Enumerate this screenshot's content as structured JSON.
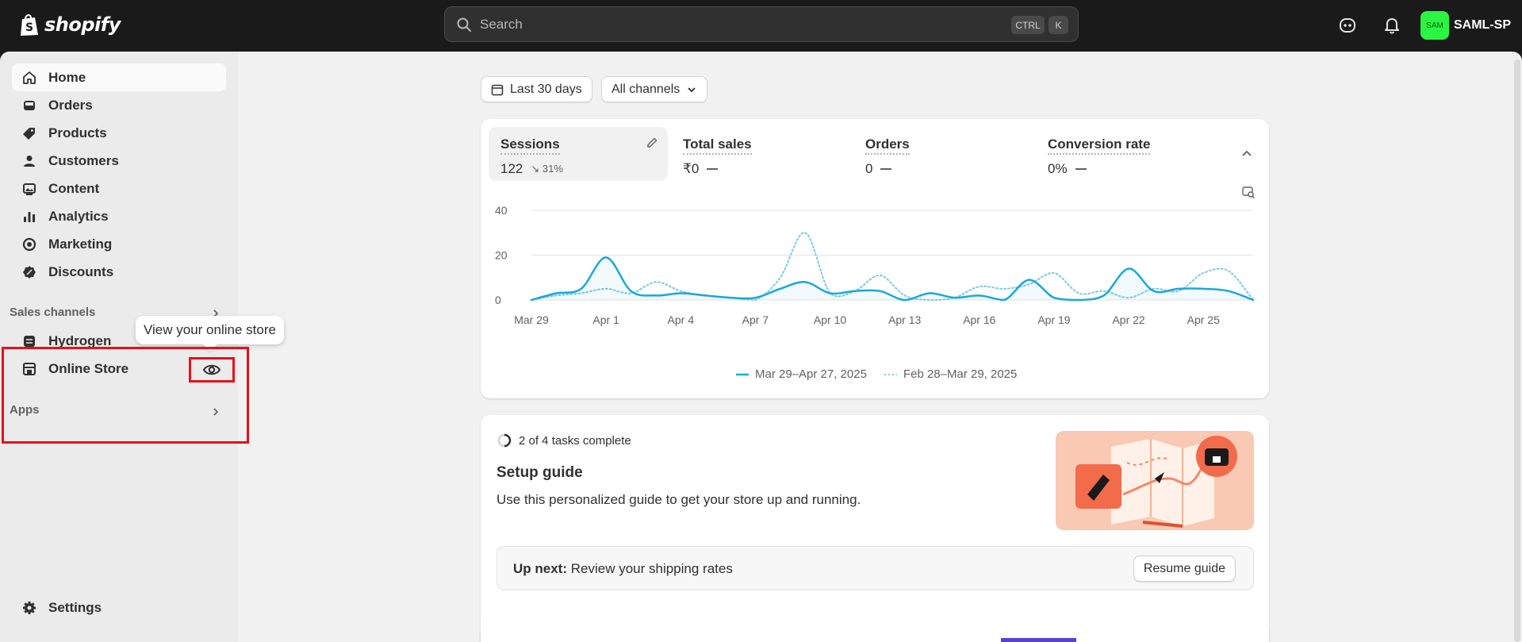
{
  "topbar": {
    "brand": "shopify",
    "search_placeholder": "Search",
    "shortcut_ctrl": "CTRL",
    "shortcut_k": "K",
    "avatar_initials": "SAM",
    "store_name": "SAML-SP",
    "avatar_color": "#2bf542"
  },
  "sidebar": {
    "items": [
      {
        "label": "Home",
        "icon": "home-icon"
      },
      {
        "label": "Orders",
        "icon": "inbox-icon"
      },
      {
        "label": "Products",
        "icon": "tag-icon"
      },
      {
        "label": "Customers",
        "icon": "person-icon"
      },
      {
        "label": "Content",
        "icon": "image-icon"
      },
      {
        "label": "Analytics",
        "icon": "bar-chart-icon"
      },
      {
        "label": "Marketing",
        "icon": "target-icon"
      },
      {
        "label": "Discounts",
        "icon": "discount-icon"
      }
    ],
    "sales_channels_label": "Sales channels",
    "channels": [
      {
        "label": "Hydrogen",
        "icon": "hydrogen-icon"
      },
      {
        "label": "Online Store",
        "icon": "store-icon"
      }
    ],
    "apps_label": "Apps",
    "settings_label": "Settings",
    "tooltip": "View your online store"
  },
  "filters": {
    "date_range": "Last 30 days",
    "channels": "All channels"
  },
  "metrics": [
    {
      "label": "Sessions",
      "value": "122",
      "change": "↘ 31%"
    },
    {
      "label": "Total sales",
      "value": "₹0"
    },
    {
      "label": "Orders",
      "value": "0"
    },
    {
      "label": "Conversion rate",
      "value": "0%"
    }
  ],
  "chart_data": {
    "type": "line",
    "title": "",
    "xlabel": "",
    "ylabel": "",
    "ylim": [
      0,
      40
    ],
    "yticks": [
      "40",
      "20",
      "0"
    ],
    "xticks": [
      "Mar 29",
      "Apr 1",
      "Apr 4",
      "Apr 7",
      "Apr 10",
      "Apr 13",
      "Apr 16",
      "Apr 19",
      "Apr 22",
      "Apr 25"
    ],
    "series": [
      {
        "name": "Mar 29–Apr 27, 2025",
        "style": "solid",
        "color": "#1ba8d8",
        "values": [
          0,
          3,
          5,
          19,
          4,
          2,
          3,
          2,
          1,
          1,
          5,
          8,
          3,
          4,
          4,
          0,
          3,
          1,
          2,
          0,
          9,
          1,
          0,
          2,
          14,
          4,
          5,
          5,
          4,
          0
        ]
      },
      {
        "name": "Feb 28–Mar 29, 2025",
        "style": "dotted",
        "color": "#7cc9e6",
        "values": [
          0,
          2,
          3,
          5,
          3,
          8,
          4,
          2,
          1,
          0,
          10,
          30,
          3,
          4,
          11,
          2,
          0,
          1,
          6,
          5,
          7,
          12,
          3,
          4,
          1,
          5,
          4,
          12,
          13,
          0
        ]
      }
    ],
    "grid": true,
    "legend": "bottom-center"
  },
  "setup_guide": {
    "progress": "2 of 4 tasks complete",
    "title": "Setup guide",
    "description": "Use this personalized guide to get your store up and running.",
    "up_next_label": "Up next:",
    "up_next_task": "Review your shipping rates",
    "resume_label": "Resume guide"
  }
}
